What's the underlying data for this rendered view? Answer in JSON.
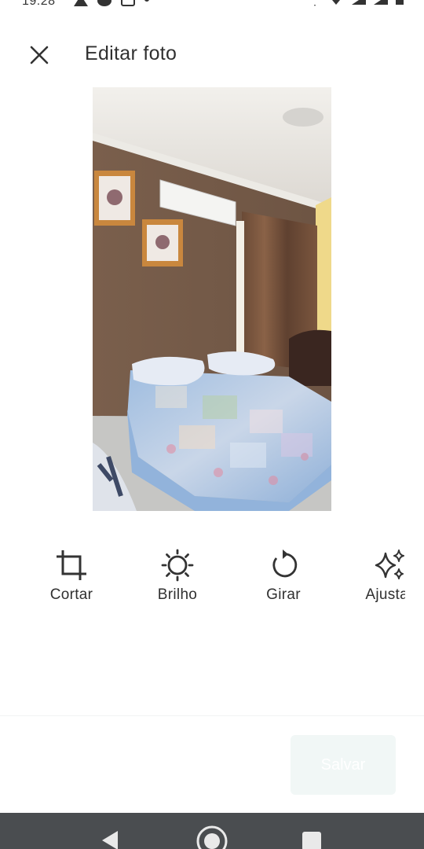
{
  "status_bar": {
    "time": "19:28"
  },
  "header": {
    "title": "Editar foto",
    "close_icon": "close-icon"
  },
  "tools": [
    {
      "label": "Cortar",
      "icon": "crop-icon"
    },
    {
      "label": "Brilho",
      "icon": "brightness-icon"
    },
    {
      "label": "Girar",
      "icon": "rotate-icon"
    },
    {
      "label": "Ajustar",
      "icon": "sparkle-icon"
    }
  ],
  "footer": {
    "save_label": "Salvar"
  },
  "colors": {
    "save_disabled_bg": "#f1f7f6",
    "nav_bar": "#4a4d50",
    "text": "#303030"
  }
}
